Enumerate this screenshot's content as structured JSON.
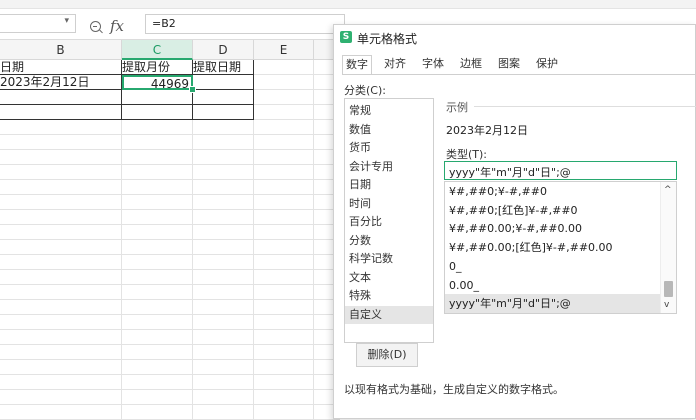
{
  "formula_bar": {
    "name_box": "",
    "name_box_arrow": "▾",
    "fx_label": "fx",
    "formula": "=B2"
  },
  "sheet": {
    "columns": [
      {
        "label": "B",
        "selected": false
      },
      {
        "label": "C",
        "selected": true
      },
      {
        "label": "D",
        "selected": false
      },
      {
        "label": "E",
        "selected": false
      }
    ],
    "header_row": [
      "日期",
      "提取月份",
      "提取日期"
    ],
    "data_row": [
      "2023年2月12日",
      "44969",
      ""
    ]
  },
  "dialog": {
    "app_icon": "S",
    "title": "单元格格式",
    "tabs": [
      "数字",
      "对齐",
      "字体",
      "边框",
      "图案",
      "保护"
    ],
    "active_tab": "数字",
    "category_label": "分类(C):",
    "categories": [
      "常规",
      "数值",
      "货币",
      "会计专用",
      "日期",
      "时间",
      "百分比",
      "分数",
      "科学记数",
      "文本",
      "特殊",
      "自定义"
    ],
    "selected_category": "自定义",
    "sample_label": "示例",
    "sample_value": "2023年2月12日",
    "type_label": "类型(T):",
    "type_value": "yyyy\"年\"m\"月\"d\"日\";@",
    "type_options": [
      "¥#,##0;¥-#,##0",
      "¥#,##0;[红色]¥-#,##0",
      "¥#,##0.00;¥-#,##0.00",
      "¥#,##0.00;[红色]¥-#,##0.00",
      "0_",
      "0.00_",
      "yyyy\"年\"m\"月\"d\"日\";@"
    ],
    "selected_type_index": 6,
    "scroll_up": "^",
    "scroll_down": "v",
    "delete_label": "删除(D)",
    "hint": "以现有格式为基础，生成自定义的数字格式。"
  },
  "colors": {
    "accent_green": "#27a86f",
    "selection_gray": "#e5e5e5"
  }
}
